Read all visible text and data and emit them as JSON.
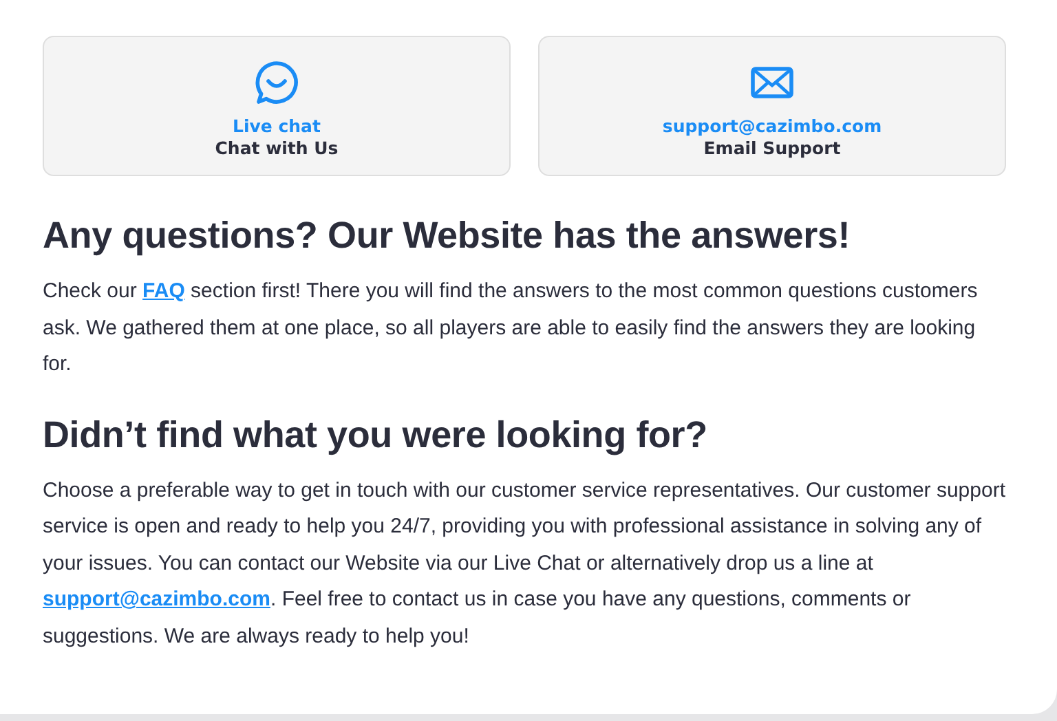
{
  "contact_cards": [
    {
      "kind": "chat",
      "link": "Live chat",
      "caption": "Chat with Us"
    },
    {
      "kind": "email",
      "link": "support@cazimbo.com",
      "caption": "Email Support"
    }
  ],
  "sections": [
    {
      "heading": "Any questions? Our Website has the answers!",
      "paragraph": [
        {
          "kind": "text",
          "text": "Check our "
        },
        {
          "kind": "link",
          "text": "FAQ"
        },
        {
          "kind": "text",
          "text": " section first! There you will find the answers to the most common questions customers ask. We gathered them at one place, so all players are able to easily find the answers they are looking for."
        }
      ]
    },
    {
      "heading": "Didn’t find what you were looking for?",
      "paragraph": [
        {
          "kind": "text",
          "text": "Choose a preferable way to get in touch with our customer service representatives. Our customer support service is open and ready to help you 24/7, providing you with professional assistance in solving any of your issues. You can contact our Website via our Live Chat or alternatively drop us a line at "
        },
        {
          "kind": "link",
          "text": "support@cazimbo.com"
        },
        {
          "kind": "text",
          "text": ". Feel free to contact us in case you have any questions, comments or suggestions. We are always ready to help you!"
        }
      ]
    }
  ]
}
